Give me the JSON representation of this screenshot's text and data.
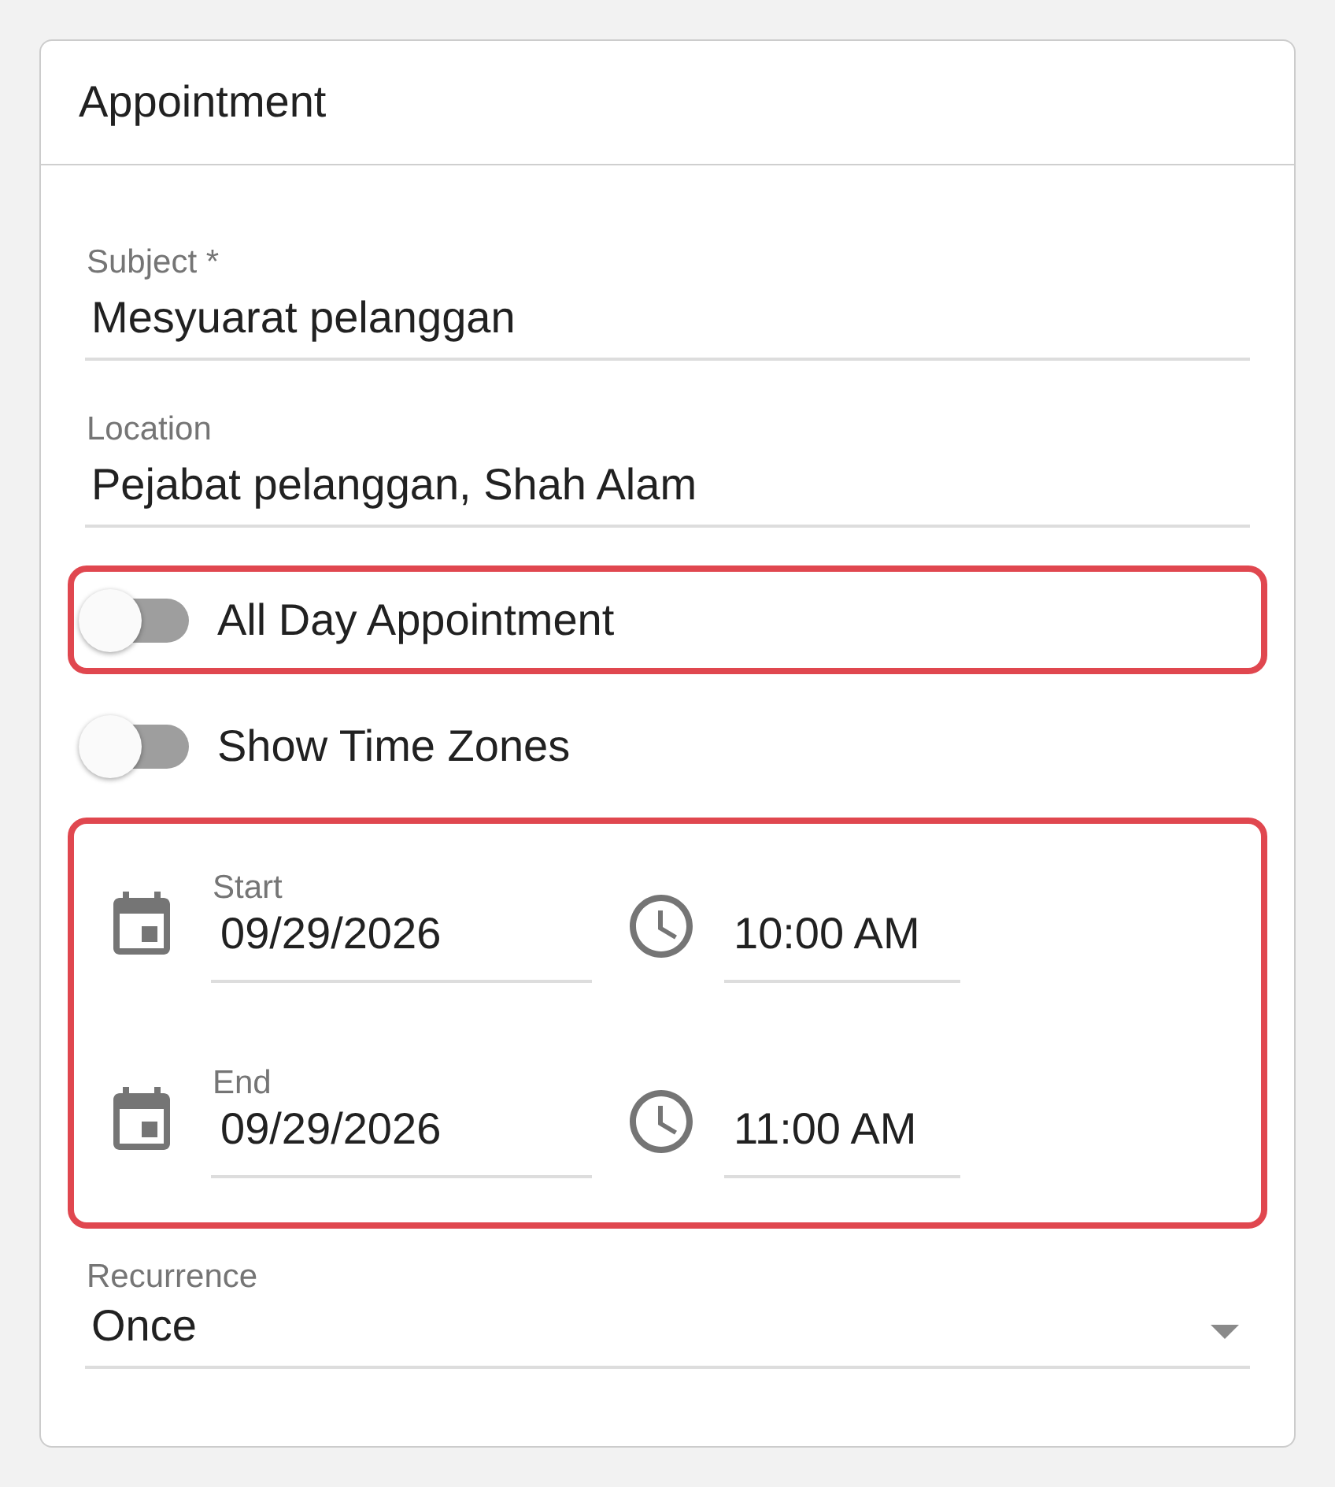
{
  "card": {
    "title": "Appointment"
  },
  "fields": [
    {
      "label": "Subject *",
      "value": "Mesyuarat pelanggan"
    },
    {
      "label": "Location",
      "value": "Pejabat pelanggan, Shah Alam"
    }
  ],
  "switches": [
    {
      "label": "All Day Appointment",
      "on": false,
      "highlighted": true
    },
    {
      "label": "Show Time Zones",
      "on": false,
      "highlighted": false
    }
  ],
  "schedule": {
    "highlighted": true,
    "rows": [
      {
        "label": "Start",
        "date": "09/29/2026",
        "time": "10:00 AM"
      },
      {
        "label": "End",
        "date": "09/29/2026",
        "time": "11:00 AM"
      }
    ]
  },
  "recurrence": {
    "label": "Recurrence",
    "value": "Once"
  }
}
